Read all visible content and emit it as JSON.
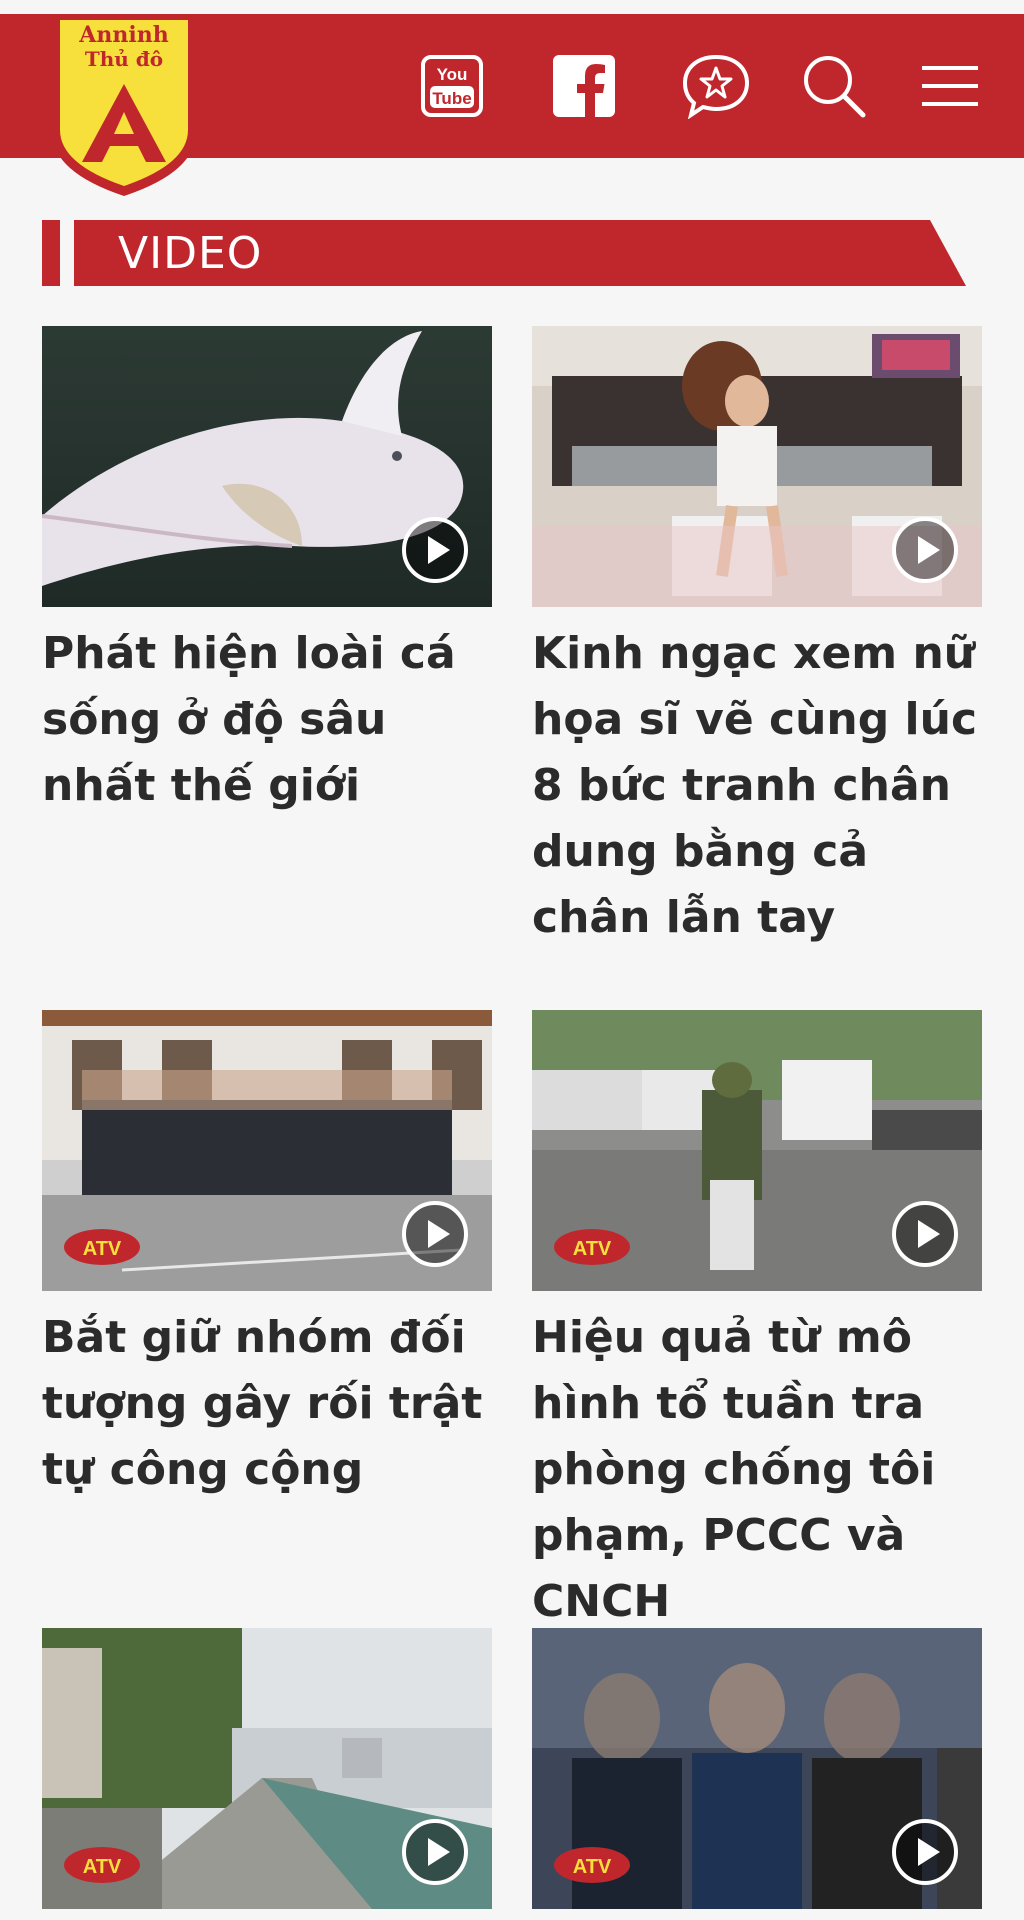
{
  "brand": {
    "logo_text_top": "Anninh",
    "logo_text_mid": "Thủ đô",
    "logo_letter": "A",
    "color_primary": "#c0272d",
    "color_logo_fill": "#f7e03c"
  },
  "header": {
    "icons": [
      "youtube-icon",
      "facebook-icon",
      "chat-star-icon",
      "search-icon",
      "menu-icon"
    ],
    "youtube_top": "You",
    "youtube_bottom": "Tube"
  },
  "section": {
    "label": "VIDEO"
  },
  "videos": [
    {
      "title": "Phát hiện loài cá sống ở độ sâu nhất thế giới"
    },
    {
      "title": "Kinh ngạc xem nữ họa sĩ vẽ cùng lúc 8 bức tranh chân dung bằng cả chân lẫn tay"
    },
    {
      "title": "Bắt giữ nhóm đối tượng gây rối trật tự công cộng"
    },
    {
      "title": "Hiệu quả từ mô hình tổ tuần tra phòng chống tôi phạm, PCCC và CNCH"
    },
    {
      "title": ""
    },
    {
      "title": ""
    }
  ],
  "watermark": "ATV"
}
